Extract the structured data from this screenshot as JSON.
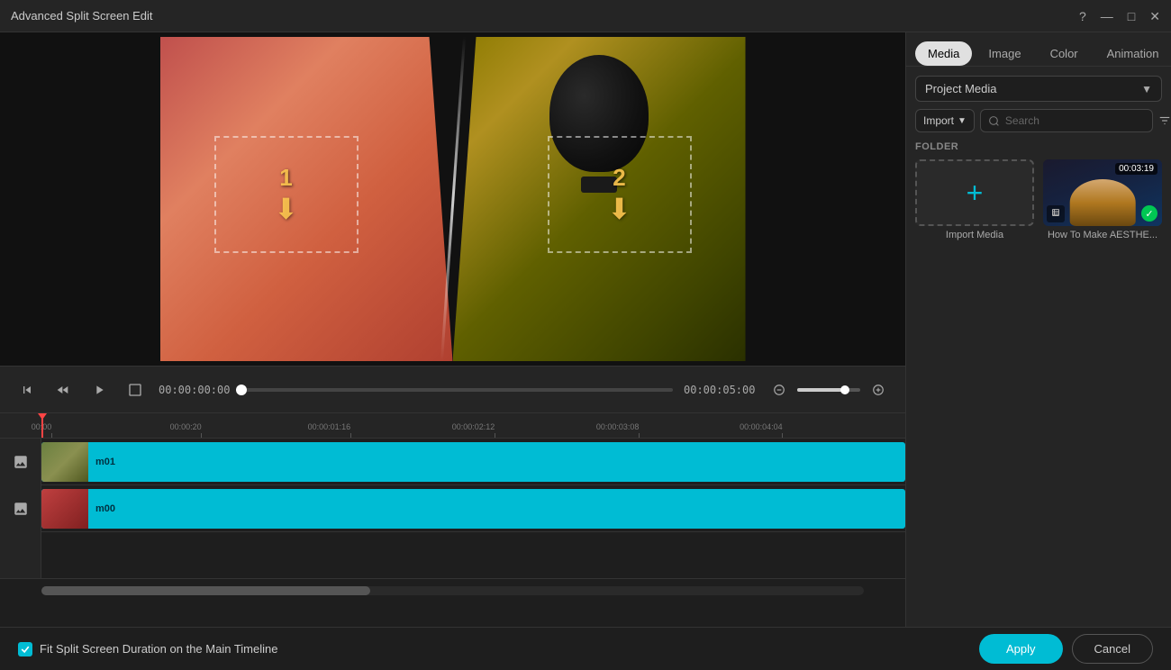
{
  "window": {
    "title": "Advanced Split Screen Edit"
  },
  "titlebar": {
    "controls": {
      "help": "?",
      "minimize": "—",
      "maximize": "□",
      "close": "✕"
    }
  },
  "preview": {
    "dropzone1_label": "1",
    "dropzone2_label": "2"
  },
  "playback": {
    "current_time": "00:00:00:00",
    "total_time": "00:00:05:00"
  },
  "timeline": {
    "ruler_marks": [
      {
        "label": "00:00",
        "pos_percent": 0
      },
      {
        "label": "00:00:20",
        "pos_percent": 16.7
      },
      {
        "label": "00:00:01:16",
        "pos_percent": 33.3
      },
      {
        "label": "00:00:02:12",
        "pos_percent": 50
      },
      {
        "label": "00:00:03:08",
        "pos_percent": 66.7
      },
      {
        "label": "00:00:04:04",
        "pos_percent": 83.3
      }
    ],
    "tracks": [
      {
        "id": "track1",
        "label": "m01",
        "icon": "image"
      },
      {
        "id": "track2",
        "label": "m00",
        "icon": "image"
      }
    ]
  },
  "right_panel": {
    "tabs": [
      {
        "id": "media",
        "label": "Media",
        "active": true
      },
      {
        "id": "image",
        "label": "Image",
        "active": false
      },
      {
        "id": "color",
        "label": "Color",
        "active": false
      },
      {
        "id": "animation",
        "label": "Animation",
        "active": false
      }
    ],
    "source_dropdown": {
      "label": "Project Media"
    },
    "import_button": "Import",
    "search_placeholder": "Search",
    "folder_label": "FOLDER",
    "media_items": [
      {
        "id": "import-media",
        "label": "Import Media",
        "type": "import"
      },
      {
        "id": "video1",
        "label": "How To Make AESTHE...",
        "type": "video",
        "timestamp": "00:03:19"
      }
    ]
  },
  "bottom_bar": {
    "checkbox_label": "Fit Split Screen Duration on the Main Timeline",
    "apply_label": "Apply",
    "cancel_label": "Cancel"
  }
}
